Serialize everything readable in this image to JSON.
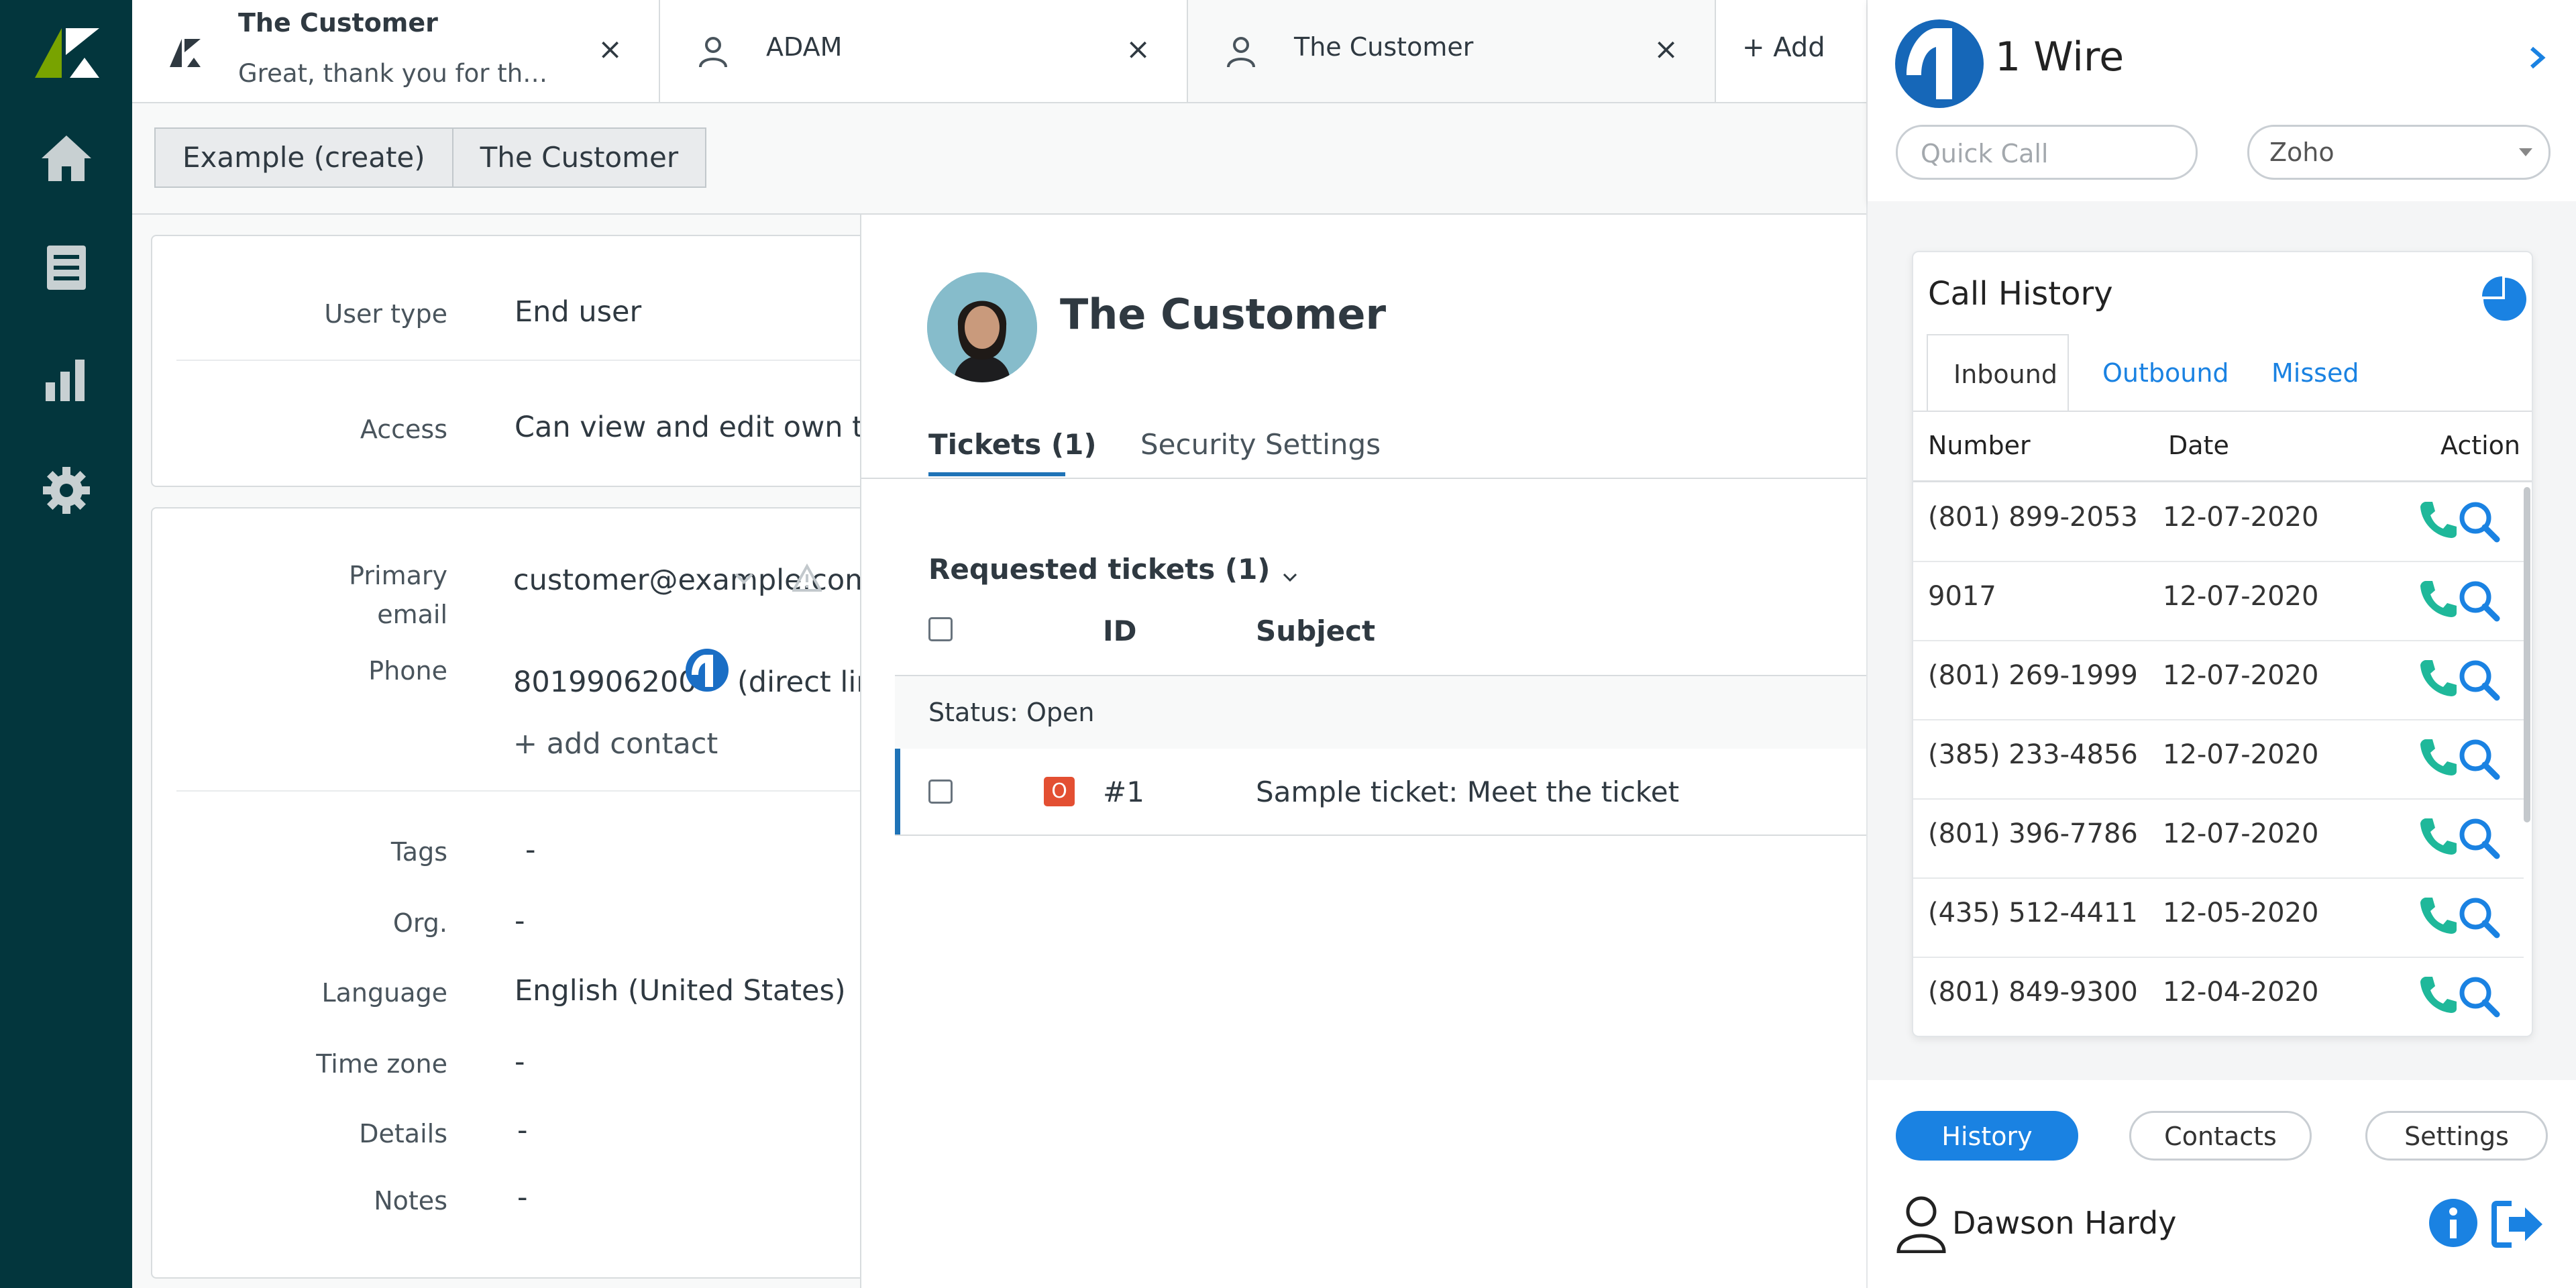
{
  "tabs": [
    {
      "title": "The Customer",
      "subtitle": "Great, thank you for the t..."
    },
    {
      "title": "ADAM"
    },
    {
      "title": "The Customer"
    }
  ],
  "tab_close": "×",
  "add_tab": "+ Add",
  "breadcrumbs": [
    "Example (create)",
    "The Customer"
  ],
  "user_fields": {
    "user_type_label": "User type",
    "user_type_value": "End user",
    "access_label": "Access",
    "access_value": "Can view and edit own tick...",
    "primary_email_label_1": "Primary",
    "primary_email_label_2": "email",
    "primary_email_value": "customer@example.com",
    "phone_label": "Phone",
    "phone_value": "8019906200",
    "phone_suffix": "(direct line)",
    "add_contact": "+ add contact",
    "tags_label": "Tags",
    "tags_value": "-",
    "org_label": "Org.",
    "org_value": "-",
    "language_label": "Language",
    "language_value": "English (United States)",
    "timezone_label": "Time zone",
    "timezone_value": "-",
    "details_label": "Details",
    "details_value": "-",
    "notes_label": "Notes",
    "notes_value": "-"
  },
  "profile": {
    "name": "The Customer",
    "tabs": [
      "Tickets (1)",
      "Security Settings"
    ]
  },
  "tickets": {
    "requested_label": "Requested tickets (1)",
    "col_id": "ID",
    "col_subject": "Subject",
    "status_group": "Status: Open",
    "rows": [
      {
        "badge": "O",
        "id": "#1",
        "subject": "Sample ticket: Meet the ticket"
      }
    ]
  },
  "wire": {
    "brand": "1 Wire",
    "quick_call_placeholder": "Quick Call",
    "crm_select": "Zoho",
    "history_title": "Call History",
    "history_tabs": [
      "Inbound",
      "Outbound",
      "Missed"
    ],
    "col_number": "Number",
    "col_date": "Date",
    "col_action": "Action",
    "calls": [
      {
        "number": "(801) 899-2053",
        "date": "12-07-2020"
      },
      {
        "number": "9017",
        "date": "12-07-2020"
      },
      {
        "number": "(801) 269-1999",
        "date": "12-07-2020"
      },
      {
        "number": "(385) 233-4856",
        "date": "12-07-2020"
      },
      {
        "number": "(801) 396-7786",
        "date": "12-07-2020"
      },
      {
        "number": "(435) 512-4411",
        "date": "12-05-2020"
      },
      {
        "number": "(801) 849-9300",
        "date": "12-04-2020"
      }
    ],
    "bottom_nav": [
      "History",
      "Contacts",
      "Settings"
    ],
    "agent_name": "Dawson Hardy",
    "accent": "#1a82e2",
    "call_green": "#1fb89a"
  }
}
